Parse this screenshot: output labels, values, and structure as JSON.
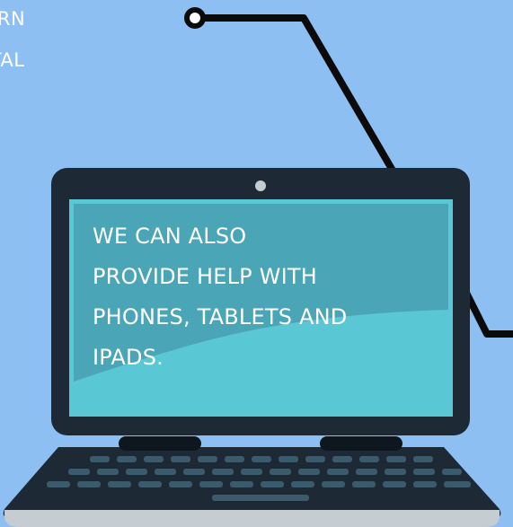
{
  "corner_text": [
    "ARN",
    "ITAL"
  ],
  "screen_text": {
    "lines": [
      "WE CAN ALSO",
      "PROVIDE HELP WITH",
      "PHONES, TABLETS AND",
      "IPADS."
    ]
  },
  "colors": {
    "background": "#8ebff3",
    "laptop_body": "#1d2a36",
    "screen_light": "#5ac7d5",
    "screen_dark": "#4aa5b6",
    "text": "#ffffff",
    "wire": "#0b0b0b"
  },
  "icons": [
    "webcam-icon",
    "wire-connector-icon"
  ]
}
